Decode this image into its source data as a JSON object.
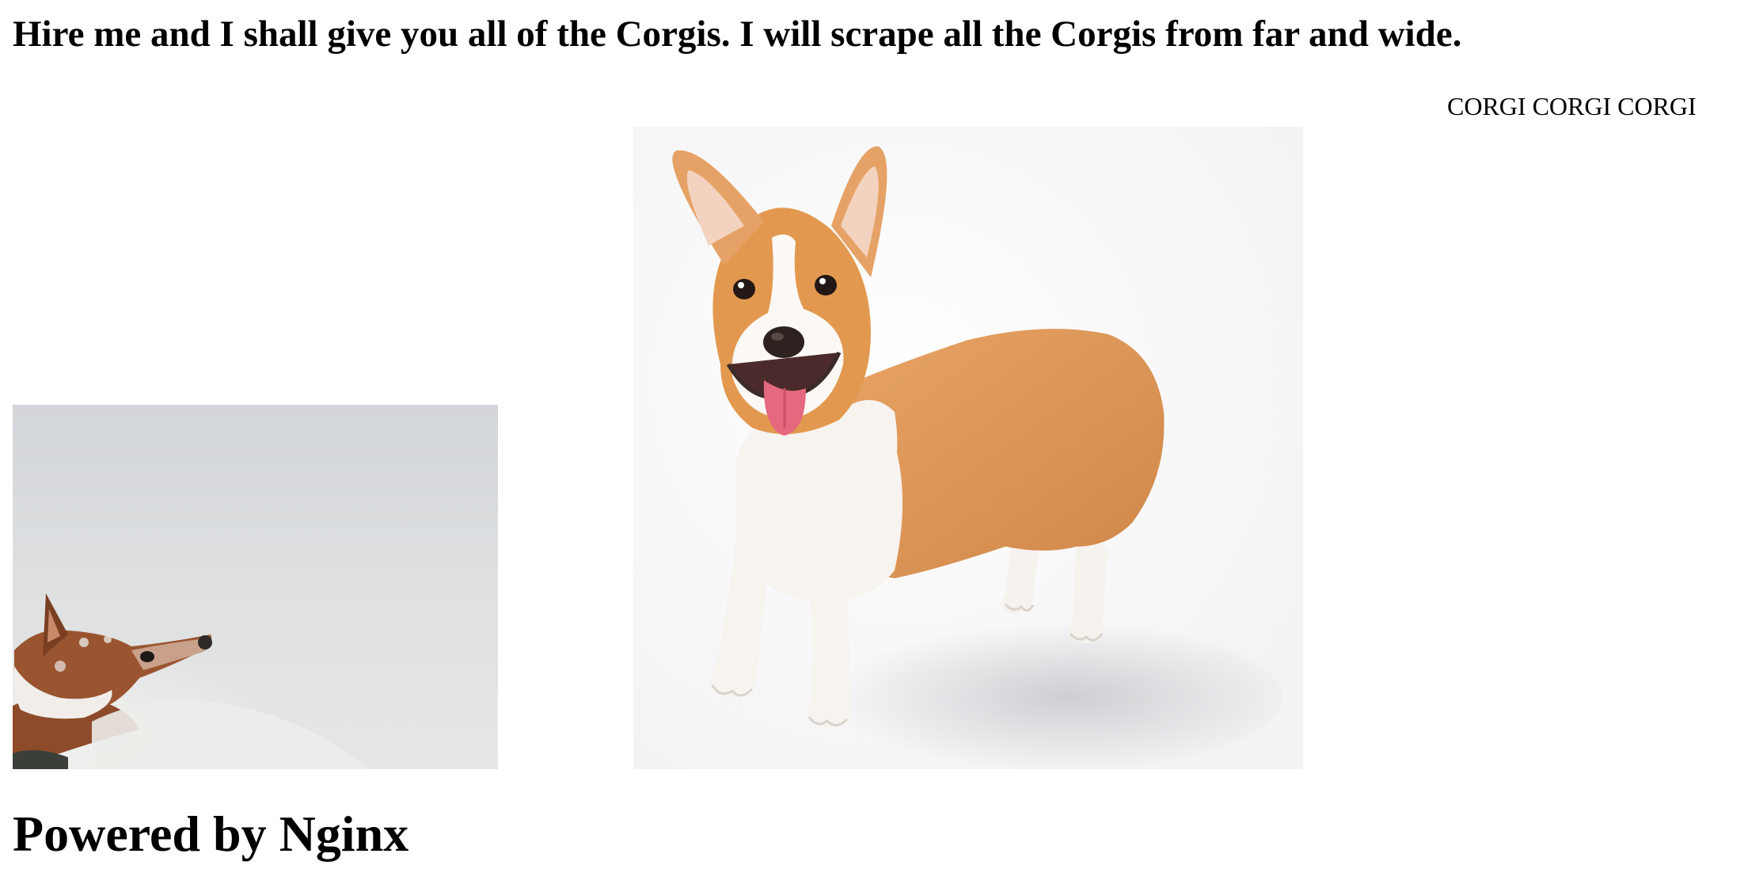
{
  "header": {
    "headline": "Hire me and I shall give you all of the Corgis. I will scrape all the Corgis from far and wide.",
    "tagline": "CORGI CORGI CORGI"
  },
  "images": {
    "snow_corgi": {
      "alt": "corgi-in-snow-image"
    },
    "standing_corgi": {
      "alt": "standing-corgi-image"
    }
  },
  "footer": {
    "powered_by": "Powered by Nginx"
  },
  "colors": {
    "background": "#ffffff",
    "text": "#000000",
    "corgi_orange": "#e0a060",
    "snow": "#dcdde0"
  }
}
